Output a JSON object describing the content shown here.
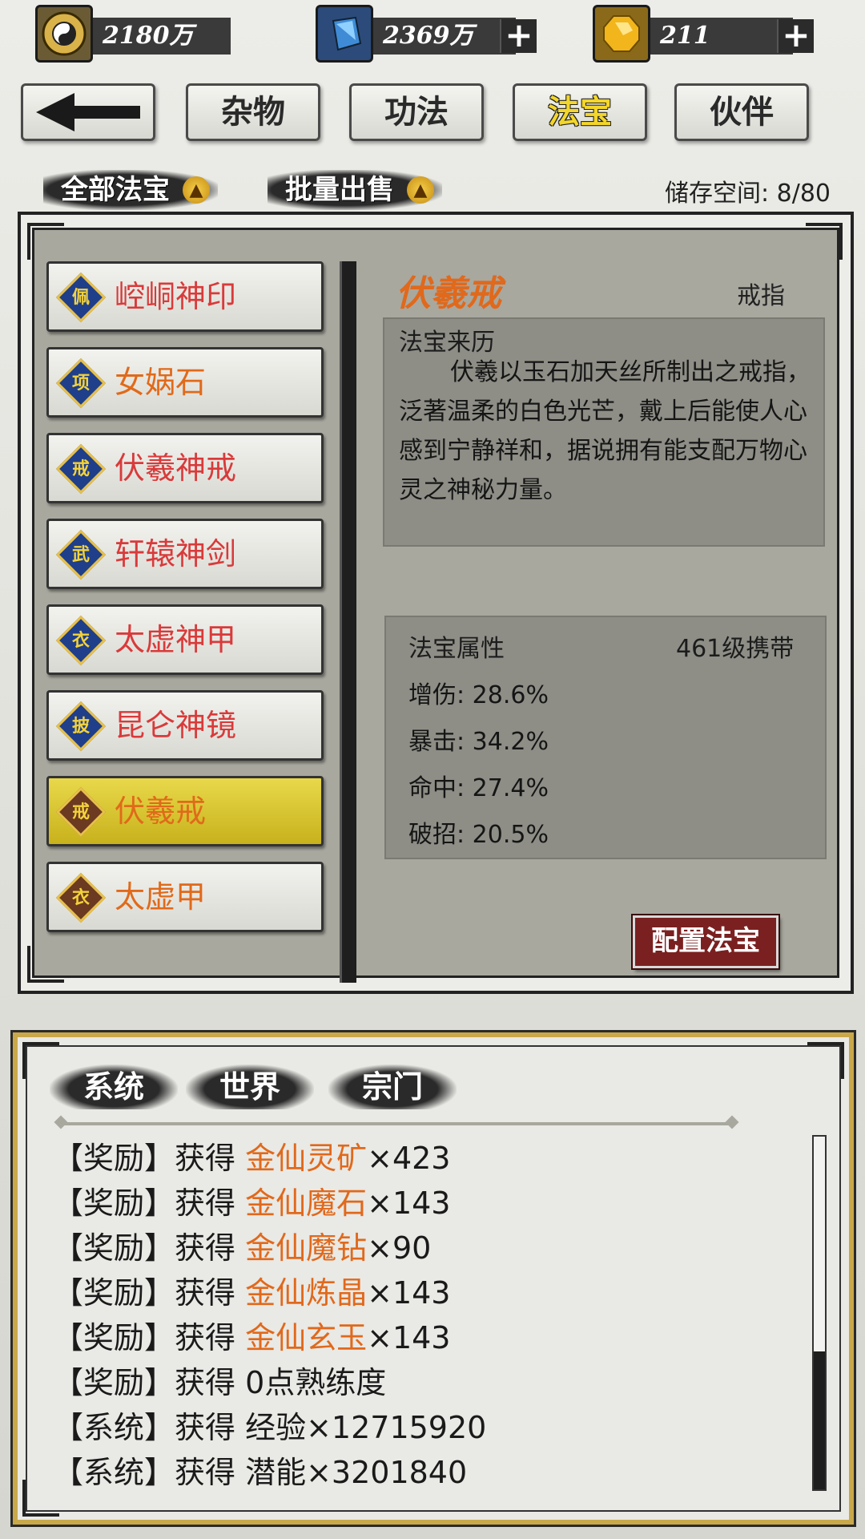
{
  "currency": [
    {
      "icon": "yin-yang-coin-icon",
      "value": "2180万",
      "has_plus": false
    },
    {
      "icon": "blue-crystal-icon",
      "value": "2369万",
      "has_plus": true
    },
    {
      "icon": "gold-gem-icon",
      "value": "211",
      "has_plus": true
    }
  ],
  "nav": {
    "back_icon": "left-arrow-icon",
    "tabs": [
      "杂物",
      "功法",
      "法宝",
      "伙伴"
    ],
    "active_tab": "法宝"
  },
  "filters": {
    "all_treasures": "全部法宝",
    "batch_sell": "批量出售",
    "storage_label": "储存空间: 8/80"
  },
  "items": [
    {
      "badge": "佩",
      "name": "崆峒神印"
    },
    {
      "badge": "项",
      "name": "女娲石"
    },
    {
      "badge": "戒",
      "name": "伏羲神戒"
    },
    {
      "badge": "武",
      "name": "轩辕神剑"
    },
    {
      "badge": "衣",
      "name": "太虚神甲"
    },
    {
      "badge": "披",
      "name": "昆仑神镜"
    },
    {
      "badge": "戒",
      "name": "伏羲戒"
    },
    {
      "badge": "衣",
      "name": "太虚甲"
    }
  ],
  "detail": {
    "title": "伏羲戒",
    "type": "戒指",
    "history_header": "法宝来历",
    "history_text": "伏羲以玉石加天丝所制出之戒指，泛著温柔的白色光芒，戴上后能使人心感到宁静祥和，据说拥有能支配万物心灵之神秘力量。",
    "attr_header": "法宝属性",
    "carry_level": "461级携带",
    "attributes": [
      "增伤: 28.6%",
      "暴击: 34.2%",
      "命中: 27.4%",
      "破招: 20.5%"
    ],
    "config_button": "配置法宝"
  },
  "chat": {
    "tabs": [
      "系统",
      "世界",
      "宗门"
    ],
    "messages": [
      {
        "prefix": "【奖励】获得 ",
        "highlight": "金仙灵矿",
        "suffix": "×423"
      },
      {
        "prefix": "【奖励】获得 ",
        "highlight": "金仙魔石",
        "suffix": "×143"
      },
      {
        "prefix": "【奖励】获得 ",
        "highlight": "金仙魔钻",
        "suffix": "×90"
      },
      {
        "prefix": "【奖励】获得 ",
        "highlight": "金仙炼晶",
        "suffix": "×143"
      },
      {
        "prefix": "【奖励】获得 ",
        "highlight": "金仙玄玉",
        "suffix": "×143"
      },
      {
        "prefix": "【奖励】获得 0点熟练度",
        "highlight": "",
        "suffix": ""
      },
      {
        "prefix": "【系统】获得 经验×12715920",
        "highlight": "",
        "suffix": ""
      },
      {
        "prefix": "【系统】获得 潜能×3201840",
        "highlight": "",
        "suffix": ""
      }
    ]
  },
  "colors": {
    "accent_orange": "#e06a1a",
    "item_red": "#d93a3a",
    "active_tab_yellow": "#f3d62a",
    "selected_item": "#d8c530",
    "config_button_bg": "#7a2020"
  }
}
